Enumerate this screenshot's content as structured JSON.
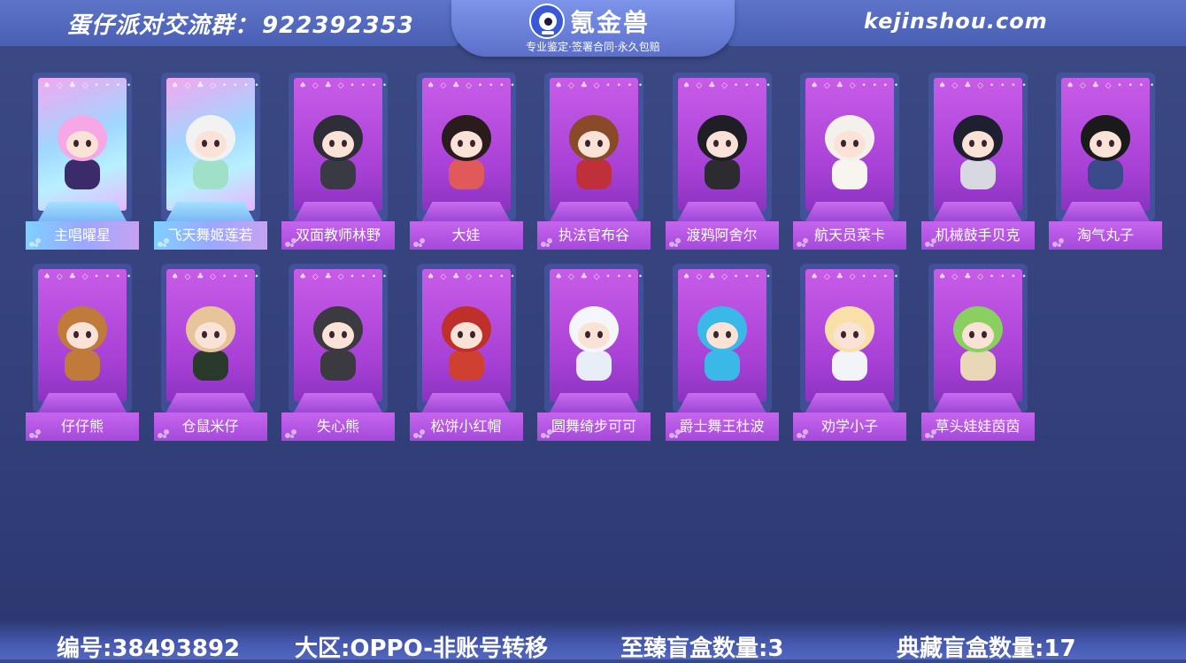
{
  "header": {
    "group_label": "蛋仔派对交流群：",
    "group_number": "922392353",
    "brand_name": "氪金兽",
    "brand_slogan": "专业鉴定·签署合同·永久包赔",
    "website": "kejinshou.com"
  },
  "cards": [
    {
      "name": "主唱曜星",
      "rarity": "rare",
      "colors": {
        "hair": "#f6a8e6",
        "outfit": "#3b2b6b"
      }
    },
    {
      "name": "飞天舞姬莲若",
      "rarity": "rare",
      "colors": {
        "hair": "#f2f2f2",
        "outfit": "#9fe0c8"
      }
    },
    {
      "name": "双面教师林野",
      "rarity": "normal",
      "colors": {
        "hair": "#2e2e38",
        "outfit": "#3a3a44"
      }
    },
    {
      "name": "大娃",
      "rarity": "normal",
      "colors": {
        "hair": "#2a1c1c",
        "outfit": "#e05a5a"
      }
    },
    {
      "name": "执法官布谷",
      "rarity": "normal",
      "colors": {
        "hair": "#8a4a2a",
        "outfit": "#c0303a"
      }
    },
    {
      "name": "渡鸦阿舍尔",
      "rarity": "normal",
      "colors": {
        "hair": "#1e1e24",
        "outfit": "#2c2c30"
      }
    },
    {
      "name": "航天员菜卡",
      "rarity": "normal",
      "colors": {
        "hair": "#f4f0ec",
        "outfit": "#f8f4f0"
      }
    },
    {
      "name": "机械鼓手贝克",
      "rarity": "normal",
      "colors": {
        "hair": "#1e2030",
        "outfit": "#d8d8e0"
      }
    },
    {
      "name": "淘气丸子",
      "rarity": "normal",
      "colors": {
        "hair": "#1a1a1a",
        "outfit": "#3b4a8a"
      }
    },
    {
      "name": "仔仔熊",
      "rarity": "normal",
      "colors": {
        "hair": "#c07a3a",
        "outfit": "#c07a3a"
      }
    },
    {
      "name": "仓鼠米仔",
      "rarity": "normal",
      "colors": {
        "hair": "#e8c49a",
        "outfit": "#2a3a2a"
      }
    },
    {
      "name": "失心熊",
      "rarity": "normal",
      "colors": {
        "hair": "#3a3a40",
        "outfit": "#3a3a40"
      }
    },
    {
      "name": "松饼小红帽",
      "rarity": "normal",
      "colors": {
        "hair": "#c0302a",
        "outfit": "#d04030"
      }
    },
    {
      "name": "圆舞绮步可可",
      "rarity": "normal",
      "colors": {
        "hair": "#f4f6fb",
        "outfit": "#e8eef8"
      }
    },
    {
      "name": "爵士舞王杜波",
      "rarity": "normal",
      "colors": {
        "hair": "#3ab8e8",
        "outfit": "#3ab8e8"
      }
    },
    {
      "name": "劝学小子",
      "rarity": "normal",
      "colors": {
        "hair": "#f8e0a8",
        "outfit": "#f2f4f8"
      }
    },
    {
      "name": "草头娃娃茵茵",
      "rarity": "normal",
      "colors": {
        "hair": "#8ad060",
        "outfit": "#e8d8b8"
      }
    }
  ],
  "card_suits": "♠ ◇ ♣ ◇ • • • •",
  "footer": {
    "id": "编号:38493892",
    "region": "大区:OPPO-非账号转移",
    "premium_boxes": "至臻盲盒数量:3",
    "collection_boxes": "典藏盲盒数量:17"
  }
}
